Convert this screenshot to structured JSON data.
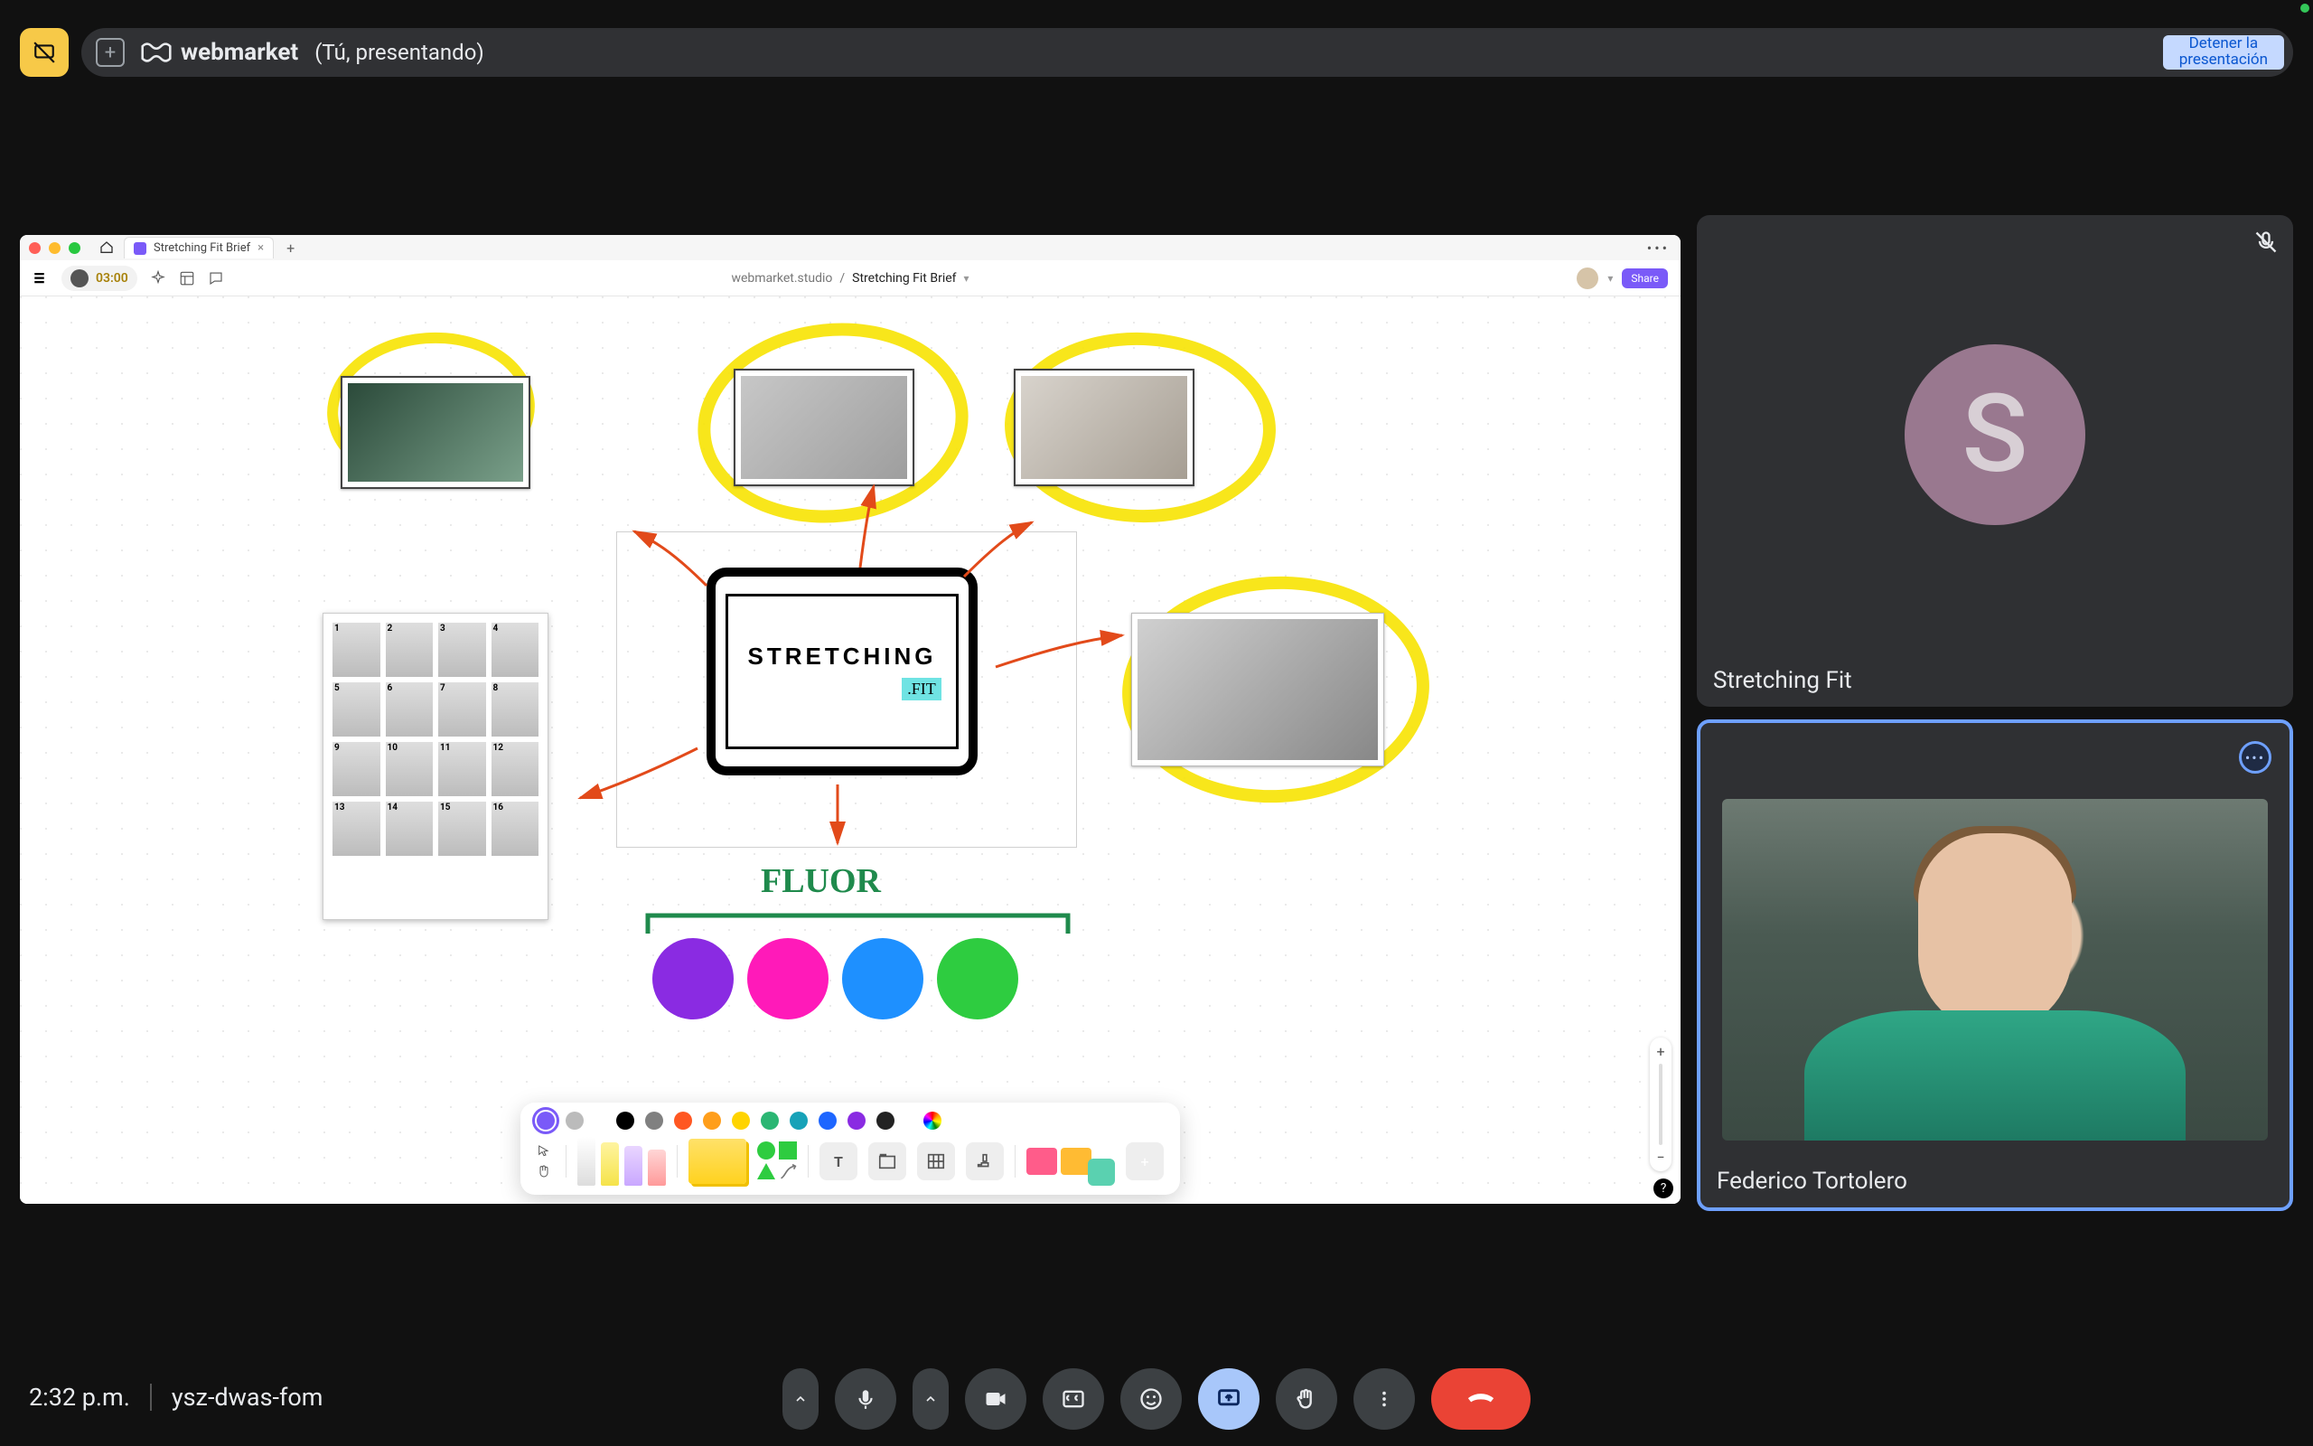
{
  "topbar": {
    "brand": "webmarket",
    "presenting": "(Tú, presentando)",
    "stop_label": "Detener la\npresentación"
  },
  "shared": {
    "tab_title": "Stretching Fit Brief",
    "timer": "03:00",
    "crumb_workspace": "webmarket.studio",
    "crumb_file": "Stretching Fit Brief",
    "share": "Share",
    "tablet_title": "STRETCHING",
    "tablet_badge": ".FIT",
    "hand_label": "FLUOR",
    "poster_numbers": [
      "1",
      "2",
      "3",
      "4",
      "5",
      "6",
      "7",
      "8",
      "9",
      "10",
      "11",
      "12",
      "13",
      "14",
      "15",
      "16"
    ],
    "palette": [
      "#8a2be2",
      "#ff1ab9",
      "#1e90ff",
      "#2ecc40"
    ],
    "swatches": [
      "#7a5af8",
      "#888888",
      "#000000",
      "#808080",
      "#ff9e1b",
      "#ff5722",
      "#ffd400",
      "#2bb673",
      "#17a2b8",
      "#1e66ff",
      "#8a2be2",
      "#222222"
    ],
    "zoom_plus": "+",
    "zoom_minus": "−",
    "help": "?"
  },
  "participants": {
    "p1_initial": "S",
    "p1_name": "Stretching Fit",
    "p2_name": "Federico Tortolero"
  },
  "bottom": {
    "time": "2:32 p.m.",
    "code": "ysz-dwas-fom"
  }
}
